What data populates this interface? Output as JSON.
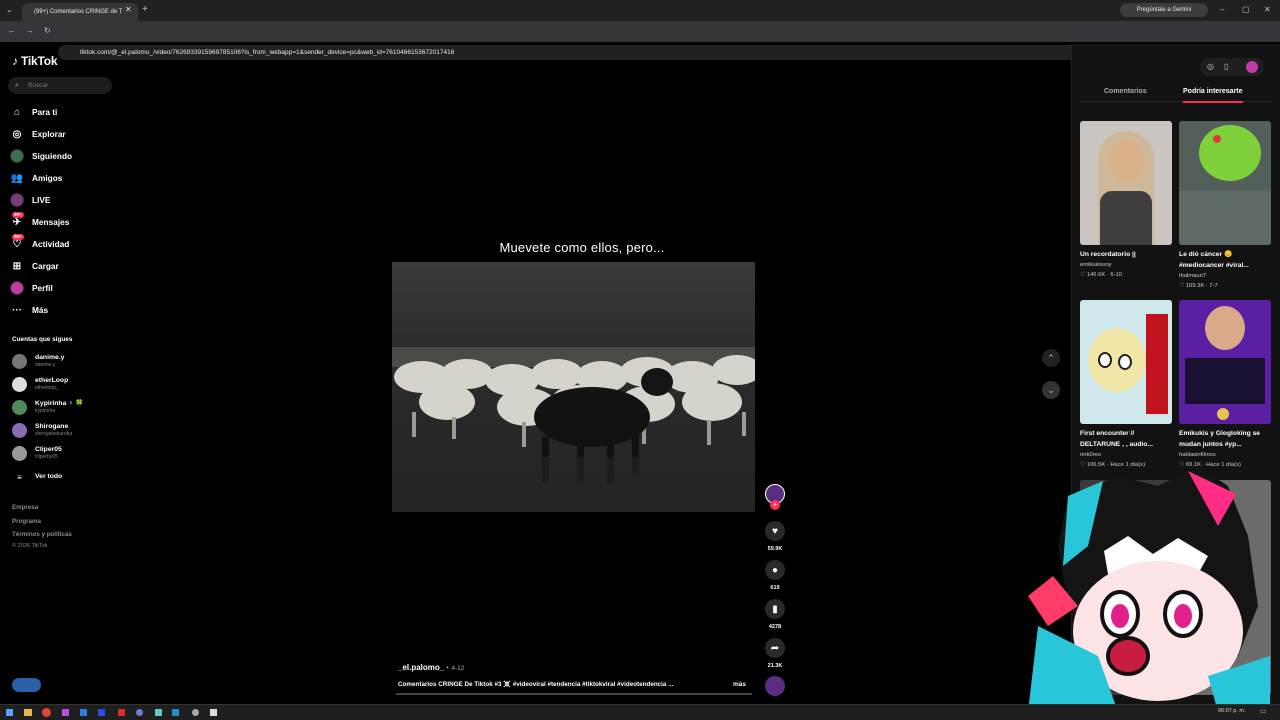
{
  "browser": {
    "tab_title": "(99+) Comentarios CRINGE de T",
    "url": "tiktok.com/@_el.palomo_/video/7626933915969785106?is_from_webapp=1&sender_device=pc&web_id=7610466153672017416",
    "gemini_button": "Pregúntale a Gemini"
  },
  "sidebar": {
    "logo": "TikTok",
    "search_placeholder": "Buscar",
    "nav": [
      {
        "label": "Para ti",
        "icon": "home-icon"
      },
      {
        "label": "Explorar",
        "icon": "compass-icon"
      },
      {
        "label": "Siguiendo",
        "icon": "avatar"
      },
      {
        "label": "Amigos",
        "icon": "friends-icon"
      },
      {
        "label": "LIVE",
        "icon": "live-avatar"
      },
      {
        "label": "Mensajes",
        "icon": "messages-icon",
        "badge": "99+"
      },
      {
        "label": "Actividad",
        "icon": "activity-icon",
        "badge": "99+"
      },
      {
        "label": "Cargar",
        "icon": "upload-icon"
      },
      {
        "label": "Perfil",
        "icon": "avatar"
      },
      {
        "label": "Más",
        "icon": "more-icon"
      }
    ],
    "following_title": "Cuentas que sigues",
    "following": [
      {
        "name": "danime.y",
        "handle": "danime.y"
      },
      {
        "name": "etherLoop",
        "handle": "etherloop_"
      },
      {
        "name": "Kypirinha ♀ 🍀",
        "handle": "kypirinha"
      },
      {
        "name": "Shirogane",
        "handle": "shiroganekuroba"
      },
      {
        "name": "Cliper05",
        "handle": "cliperby05"
      }
    ],
    "see_all": "Ver todo",
    "footer": [
      "Empresa",
      "Programa",
      "Términos y políticas",
      "© 2026 TikTok"
    ]
  },
  "video": {
    "caption": "Muevete como ellos, pero...",
    "author": "_el.palomo_",
    "date": "4-12",
    "description": "Comentarios CRINGE De Tiktok #3 ☠️ #videoviral #tendencia #tiktokviral #videotendencia ...",
    "more_label": "más",
    "likes": "59.9K",
    "comments": "619",
    "saves": "4278",
    "shares": "21.3K"
  },
  "right_panel": {
    "tabs": [
      "Comentarios",
      "Podría interesarte"
    ],
    "active_tab": 1,
    "cards": [
      {
        "title": "Un recordatorio ||",
        "author": "emikukissoy",
        "views": "146.6K",
        "date": "6-10",
        "thumb": "woman-talking"
      },
      {
        "title": "Le dió cáncer 😔 #mediocancer #viral...",
        "author": "thalmauri7",
        "views": "109.3K",
        "date": "7-7",
        "thumb": "green-balloon"
      },
      {
        "title": "First encounter // DELTARUNE , , audio...",
        "author": "rink0reo",
        "views": "106.5K",
        "date": "Hace 1 día(s)",
        "thumb": "cartoon-sheep"
      },
      {
        "title": "Emikukis y Glogloking se mudan juntos #yp...",
        "author": "hablasinfilross",
        "views": "69.1K",
        "date": "Hace 1 día(s)",
        "thumb": "streamer"
      }
    ]
  },
  "taskbar": {
    "time": "06:07 p. m."
  }
}
